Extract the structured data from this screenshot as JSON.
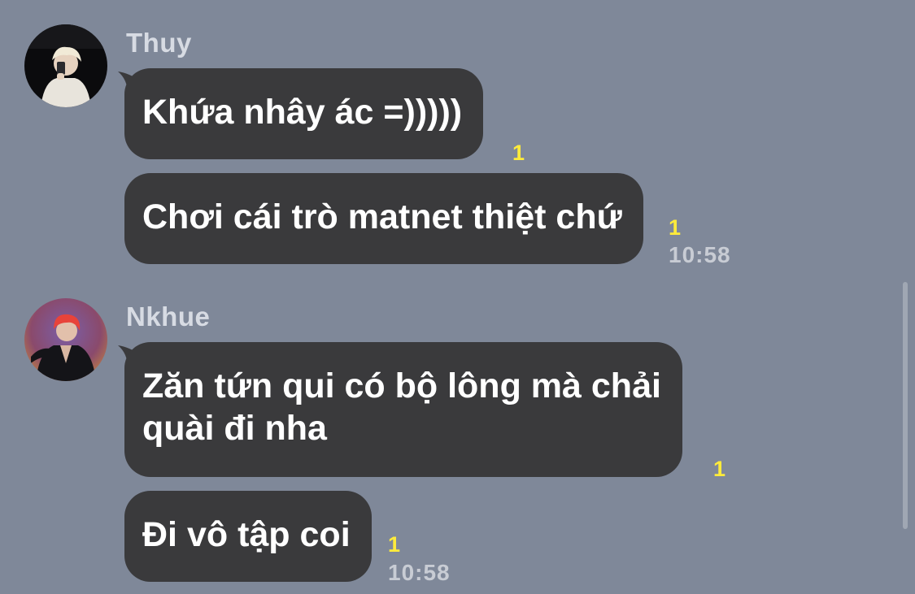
{
  "messages": [
    {
      "sender": "Thuy",
      "avatar_icon": "person-selfie-avatar",
      "bubbles": [
        {
          "text": "Khứa nhây ác =)))))",
          "unread": "1"
        },
        {
          "text": "Chơi cái trò matnet thiệt chứ",
          "unread": "1",
          "time": "10:58"
        }
      ]
    },
    {
      "sender": "Nkhue",
      "avatar_icon": "person-red-hair-avatar",
      "bubbles": [
        {
          "text_lines": [
            "Zăn tứn qui có bộ lông mà chải",
            "quài đi nha"
          ],
          "unread": "1"
        },
        {
          "text": "Đi vô tập coi",
          "unread": "1",
          "time": "10:58"
        }
      ]
    }
  ],
  "colors": {
    "background": "#7f8899",
    "bubble": "#3a3a3c",
    "unread": "#ffeb3b",
    "text": "#ffffff"
  }
}
